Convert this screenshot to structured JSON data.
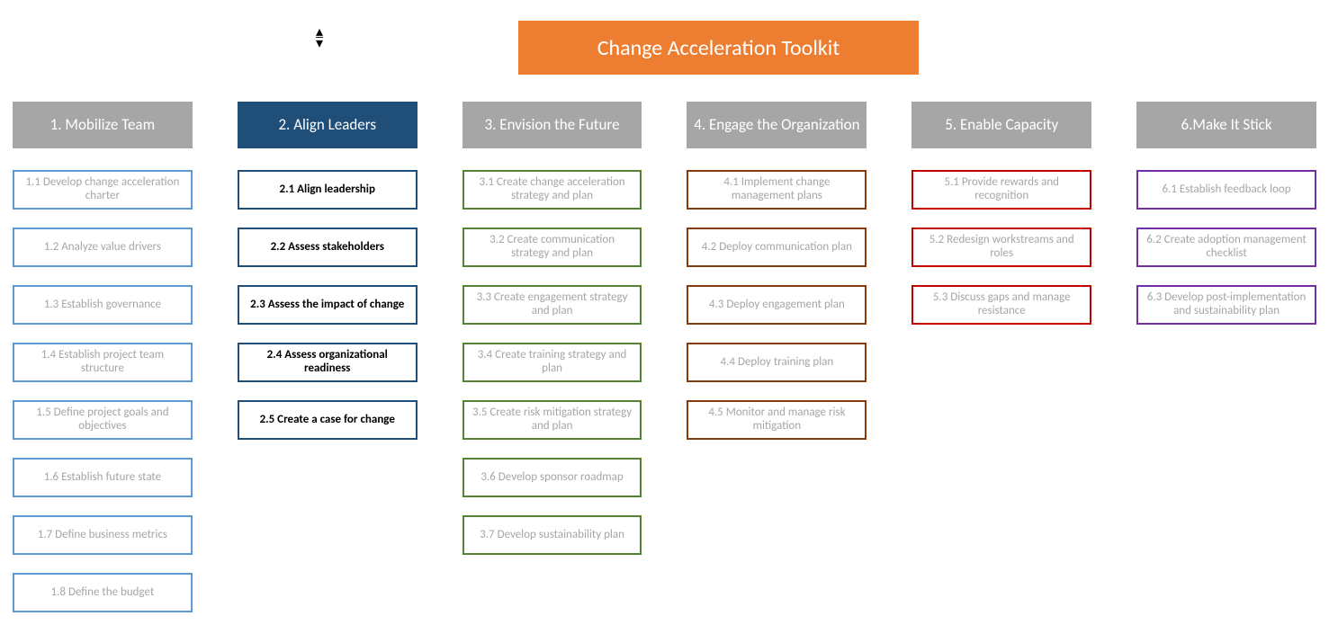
{
  "title": "Change Acceleration Toolkit",
  "activeColumn": 1,
  "columns": [
    {
      "header": "1. Mobilize Team",
      "items": [
        "1.1 Develop change acceleration charter",
        "1.2 Analyze value drivers",
        "1.3 Establish governance",
        "1.4 Establish project team structure",
        "1.5 Define project goals and objectives",
        "1.6 Establish future state",
        "1.7 Define business metrics",
        "1.8 Define the budget"
      ]
    },
    {
      "header": "2. Align Leaders",
      "items": [
        "2.1 Align leadership",
        "2.2 Assess stakeholders",
        "2.3 Assess the impact of change",
        "2.4 Assess organizational readiness",
        "2.5 Create a case for change"
      ]
    },
    {
      "header": "3. Envision the Future",
      "items": [
        "3.1 Create change acceleration strategy and plan",
        "3.2 Create communication strategy and plan",
        "3.3 Create engagement strategy and plan",
        "3.4 Create training strategy and plan",
        "3.5 Create risk mitigation strategy and plan",
        "3.6 Develop sponsor roadmap",
        "3.7 Develop sustainability plan"
      ]
    },
    {
      "header": "4. Engage the Organization",
      "items": [
        "4.1 Implement change management plans",
        "4.2 Deploy communication plan",
        "4.3 Deploy engagement plan",
        "4.4 Deploy training plan",
        "4.5 Monitor and manage risk mitigation"
      ]
    },
    {
      "header": "5. Enable Capacity",
      "items": [
        "5.1 Provide rewards and recognition",
        "5.2 Redesign workstreams and roles",
        "5.3 Discuss gaps and manage resistance"
      ]
    },
    {
      "header": "6.Make It Stick",
      "items": [
        "6.1 Establish feedback loop",
        "6.2 Create adoption management checklist",
        "6.3 Develop post-implementation and sustainability plan"
      ]
    }
  ]
}
